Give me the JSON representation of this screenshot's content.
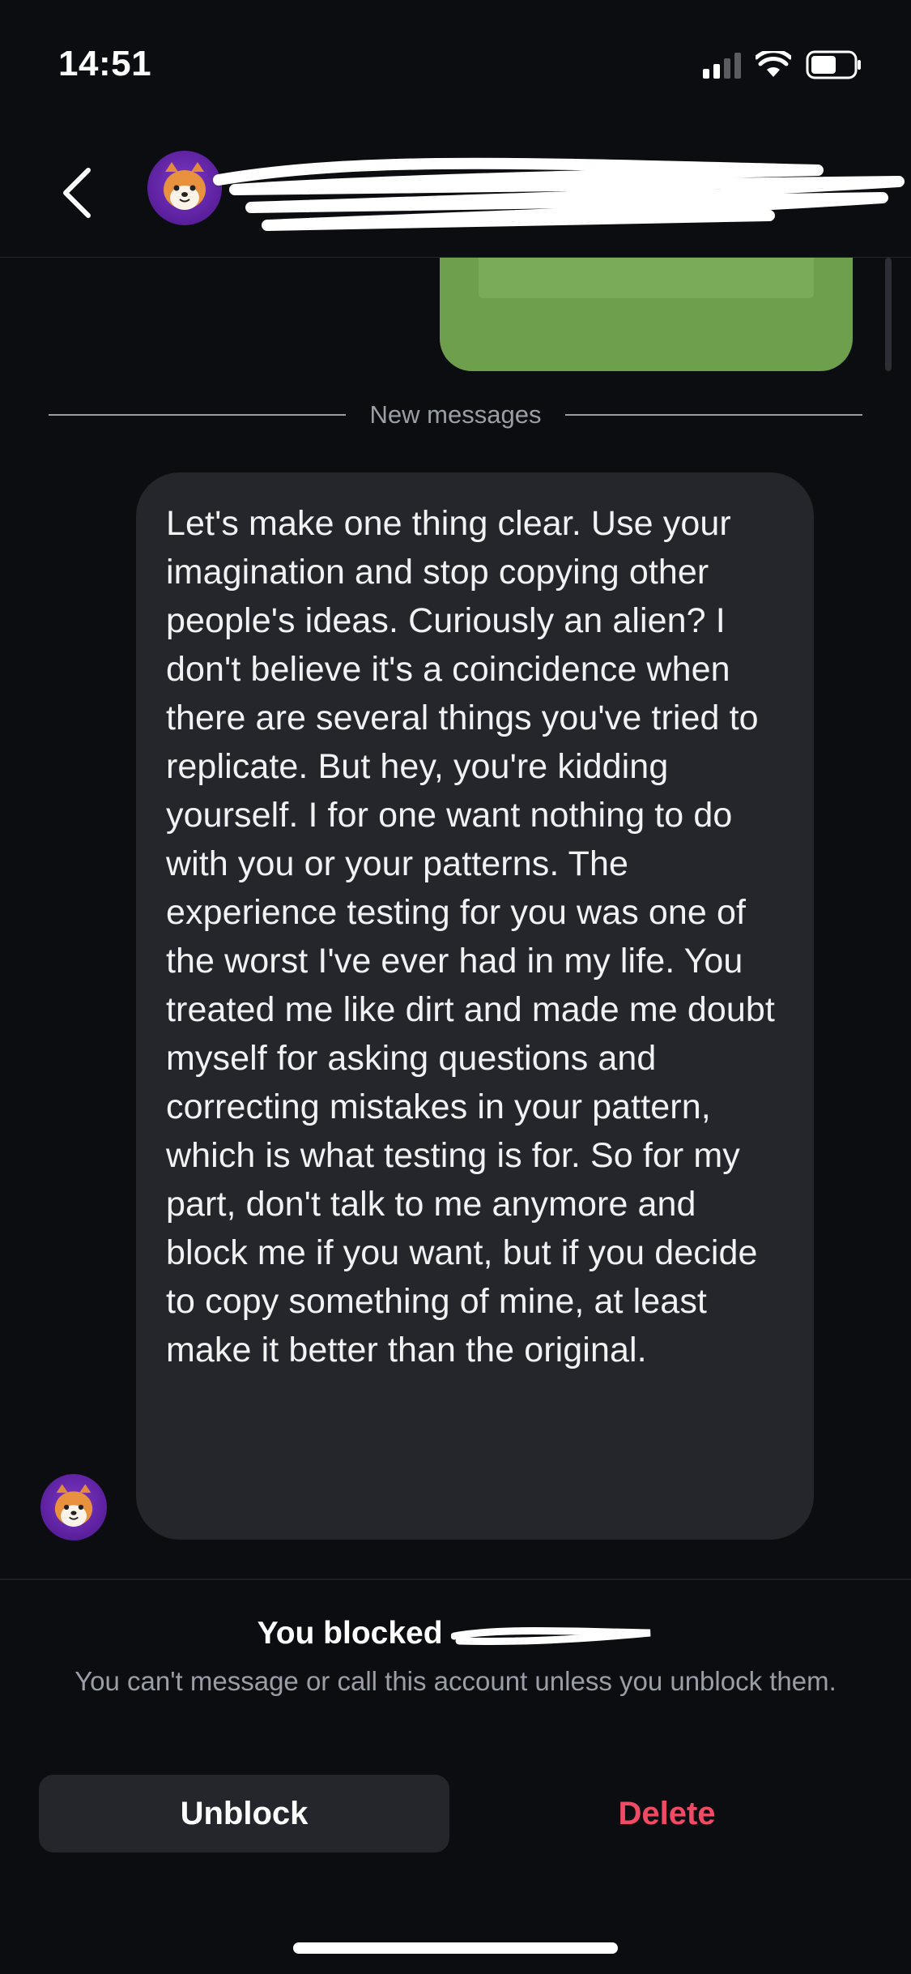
{
  "status_bar": {
    "time": "14:51",
    "icons": [
      "cellular-signal-icon",
      "wifi-icon",
      "battery-icon"
    ]
  },
  "header": {
    "back_icon": "chevron-left-icon",
    "contact_avatar": "shiba-inu-avatar",
    "contact_name_redacted": true
  },
  "chat": {
    "new_messages_label": "New messages",
    "received_message": "Let's make one thing clear. Use your imagination and stop copying other people's ideas. Curiously an alien? I don't believe it's a coincidence when there are several things you've tried to replicate. But hey, you're kidding yourself. I for one want nothing to do with you or your patterns. The experience testing for you was one of the worst I've ever had in my life. You treated me like dirt and made me doubt myself for asking questions and correcting mistakes in your pattern, which is what testing is for. So for my part, don't talk to me anymore and block me if you want, but if you decide to copy something of mine, at least make it better than the original."
  },
  "blocked": {
    "title_prefix": "You blocked",
    "description": "You can't message or call this account unless you unblock them.",
    "unblock_label": "Unblock",
    "delete_label": "Delete"
  },
  "colors": {
    "background": "#0b0d11",
    "bubble_received": "#24262b",
    "bubble_sent": "#6e9f4d",
    "delete_red": "#f04a64",
    "avatar_purple": "#6a2bb3"
  }
}
